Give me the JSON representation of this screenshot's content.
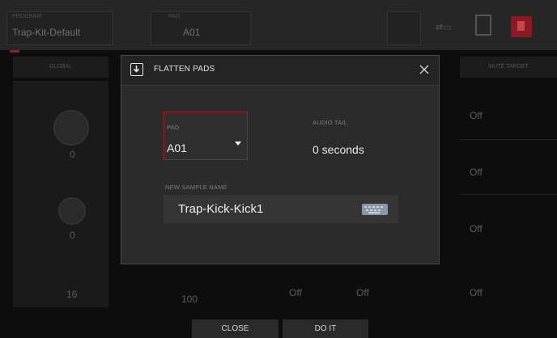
{
  "background": {
    "program_label": "PROGRAM",
    "program_name": "Trap-Kit-Default",
    "pad_label": "PAD",
    "pad_name": "A01",
    "columns": [
      "GLOBAL",
      "",
      "",
      "",
      "MUTE TARGET"
    ],
    "left_values": [
      "0",
      "0",
      "16"
    ],
    "right_values": [
      "Off",
      "Off",
      "Off",
      "Off"
    ],
    "bottom_values": [
      "100",
      "Off",
      "Off"
    ]
  },
  "dialog": {
    "title": "FLATTEN PADS",
    "pad_label": "PAD",
    "pad_value": "A01",
    "audio_tail_label": "AUDIO TAIL",
    "audio_tail_value": "0 seconds",
    "sample_name_label": "NEW SAMPLE NAME",
    "sample_name_value": "Trap-Kick-Kick1"
  },
  "footer": {
    "close_label": "CLOSE",
    "do_it_label": "DO IT"
  },
  "colors": {
    "accent_red": "#a01e2a",
    "dialog_bg": "#2b2b2b"
  }
}
